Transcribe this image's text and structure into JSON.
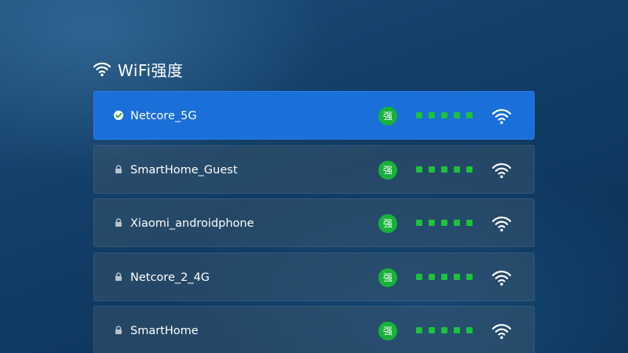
{
  "header": {
    "title": "WiFi强度",
    "icon": "wifi-icon"
  },
  "networks": [
    {
      "ssid": "Netcore_5G",
      "strength_label": "强",
      "signal_level": 5,
      "selected": true,
      "status_icon": "check-icon"
    },
    {
      "ssid": "SmartHome_Guest",
      "strength_label": "强",
      "signal_level": 5,
      "selected": false,
      "status_icon": "lock-icon"
    },
    {
      "ssid": "Xiaomi_androidphone",
      "strength_label": "强",
      "signal_level": 5,
      "selected": false,
      "status_icon": "lock-icon"
    },
    {
      "ssid": "Netcore_2_4G",
      "strength_label": "强",
      "signal_level": 5,
      "selected": false,
      "status_icon": "lock-icon"
    },
    {
      "ssid": "SmartHome",
      "strength_label": "强",
      "signal_level": 5,
      "selected": false,
      "status_icon": "lock-icon"
    }
  ],
  "colors": {
    "selected_row": "#1a6fd8",
    "row": "#3b5570",
    "badge": "#17b23a",
    "signal_dot": "#1bc33a"
  }
}
